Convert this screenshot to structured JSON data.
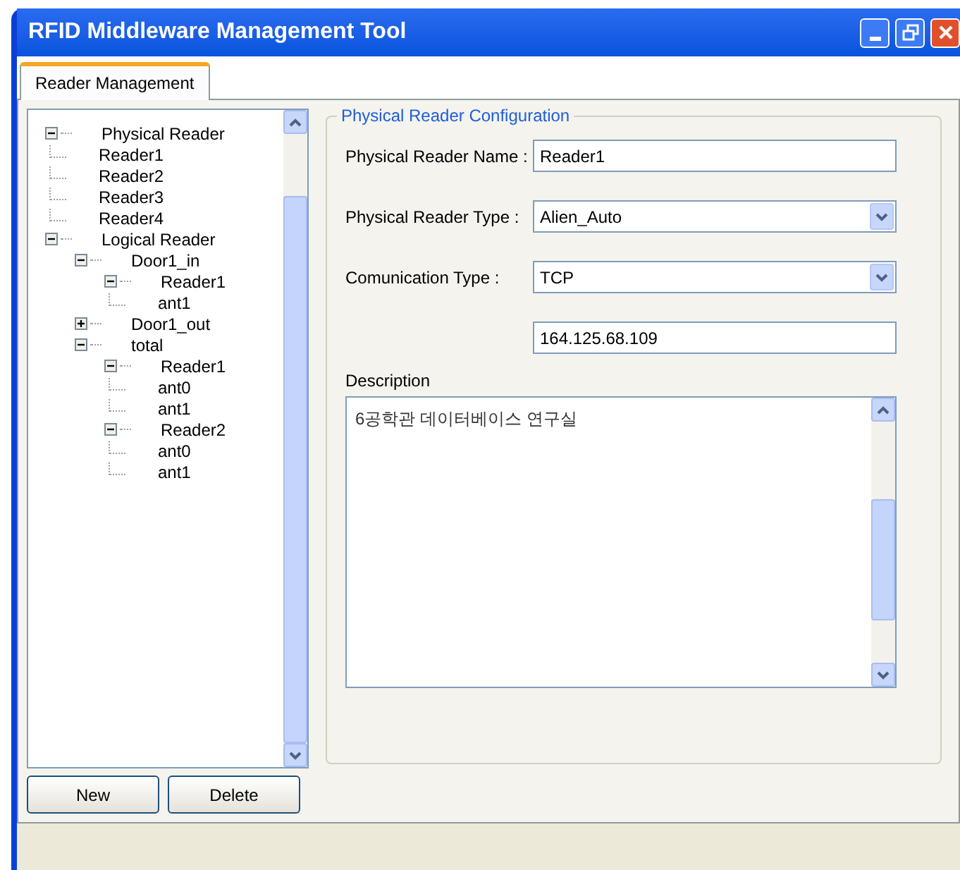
{
  "window": {
    "title": "RFID Middleware Management Tool"
  },
  "tabs": [
    {
      "label": "Reader Management",
      "selected": true
    }
  ],
  "tree": [
    {
      "label": "Physical Reader",
      "expanded": true,
      "children": [
        {
          "label": "Reader1"
        },
        {
          "label": "Reader2"
        },
        {
          "label": "Reader3"
        },
        {
          "label": "Reader4"
        }
      ]
    },
    {
      "label": "Logical Reader",
      "expanded": true,
      "children": [
        {
          "label": "Door1_in",
          "expanded": true,
          "children": [
            {
              "label": "Reader1",
              "expanded": true,
              "children": [
                {
                  "label": "ant1"
                }
              ]
            }
          ]
        },
        {
          "label": "Door1_out",
          "expanded": false
        },
        {
          "label": "total",
          "expanded": true,
          "children": [
            {
              "label": "Reader1",
              "expanded": true,
              "children": [
                {
                  "label": "ant0"
                },
                {
                  "label": "ant1"
                }
              ]
            },
            {
              "label": "Reader2",
              "expanded": true,
              "children": [
                {
                  "label": "ant0"
                },
                {
                  "label": "ant1"
                }
              ]
            }
          ]
        }
      ]
    }
  ],
  "tree_buttons": [
    "New",
    "Delete"
  ],
  "config": {
    "title": "Physical Reader Configuration",
    "fields": [
      {
        "label": "Physical Reader Name :",
        "kind": "text",
        "value": "Reader1"
      },
      {
        "label": "Physical Reader Type :",
        "kind": "dropdown",
        "value": "Alien_Auto"
      },
      {
        "label": "Comunication Type :",
        "kind": "dropdown",
        "value": "TCP"
      },
      {
        "kind": "text",
        "value": "164.125.68.109"
      }
    ],
    "description": {
      "label": "Description",
      "value": "6공학관 데이터베이스 연구실"
    }
  }
}
